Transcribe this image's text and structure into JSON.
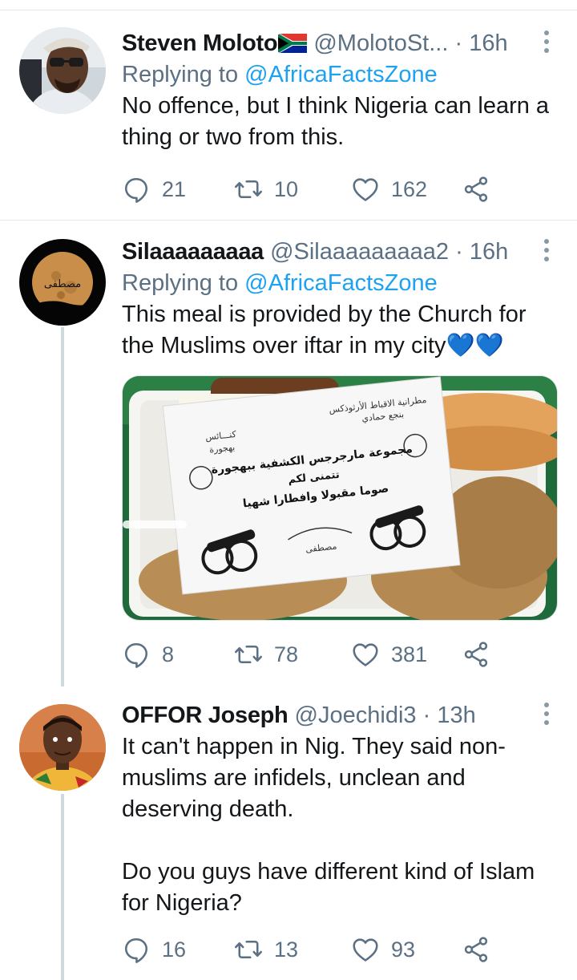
{
  "tweets": [
    {
      "name": "Steven Moloto",
      "handle": "@MolotoSt...",
      "dot": "·",
      "time": "16h",
      "replying_prefix": "Replying to ",
      "replying_to": "@AfricaFactsZone",
      "text": "No offence, but I think Nigeria can learn a thing or two from this.",
      "replies": "21",
      "retweets": "10",
      "likes": "162"
    },
    {
      "name": "Silaaaaaaaaa",
      "handle": "@Silaaaaaaaaa2",
      "dot": "·",
      "time": "16h",
      "replying_prefix": "Replying to ",
      "replying_to": "@AfricaFactsZone",
      "text": "This meal is provided by the Church for the Muslims over iftar in my city💙💙",
      "avatar_text": "مصطفى",
      "replies": "8",
      "retweets": "78",
      "likes": "381",
      "media": {
        "card_header": "مطرانية الاقباط الأرثوذكس",
        "card_header2": "بنجع حمادي",
        "card_left1": "كنـــائس",
        "card_left2": "بهجورة",
        "card_line1": "مجموعة مارجرجس الكشفية ببهجورة",
        "card_line2": "تتمنى لكم",
        "card_line3": "صوما مقبولا وافطارا شهيا",
        "card_sign": "مصطفى"
      }
    },
    {
      "name": "OFFOR Joseph",
      "handle": "@Joechidi3",
      "dot": "·",
      "time": "13h",
      "text": "It can't happen in Nig. They said non-muslims are infidels, unclean and deserving death.\n\nDo you guys have different kind of Islam for Nigeria?",
      "replies": "16",
      "retweets": "13",
      "likes": "93"
    }
  ],
  "icons": {
    "reply": "reply-icon",
    "retweet": "retweet-icon",
    "like": "heart-icon",
    "share": "share-icon",
    "more": "more-icon",
    "flag": "south-africa-flag-icon"
  },
  "colors": {
    "link": "#1da1f2",
    "secondary": "#5b7083",
    "divider": "#e1e8ed",
    "thread_line": "#cfd9de"
  }
}
